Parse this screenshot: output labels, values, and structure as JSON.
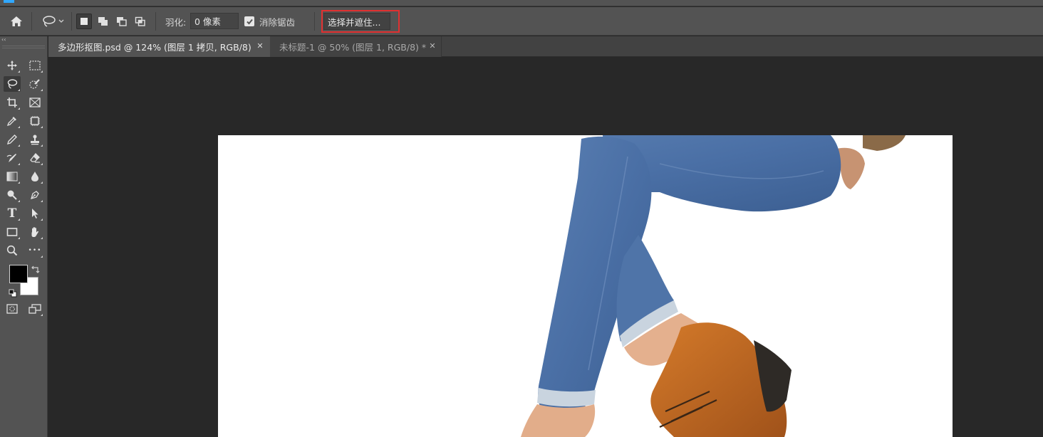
{
  "colors": {
    "panel": "#535353",
    "workspace": "#282828",
    "highlight": "#e03030",
    "foreground": "#000000",
    "background": "#ffffff"
  },
  "options_bar": {
    "feather_label": "羽化:",
    "feather_value": "0 像素",
    "antialias_label": "消除锯齿",
    "antialias_checked": true,
    "select_and_mask_label": "选择并遮住..."
  },
  "tabs": [
    {
      "title": "多边形抠图.psd @ 124% (图层 1 拷贝, RGB/8)",
      "active": true
    },
    {
      "title": "未标题-1 @ 50% (图层 1, RGB/8) *",
      "active": false
    }
  ],
  "toolbar": {
    "collapse_glyph": "‹‹",
    "tools": [
      "move-tool",
      "rectangular-marquee-tool",
      "lasso-tool",
      "quick-selection-tool",
      "crop-tool",
      "frame-tool",
      "eyedropper-tool",
      "content-aware-tool",
      "brush-tool",
      "clone-stamp-tool",
      "history-brush-tool",
      "eraser-tool",
      "gradient-tool",
      "blur-tool",
      "dodge-tool",
      "pen-tool",
      "type-tool",
      "path-selection-tool",
      "rectangle-tool",
      "hand-tool",
      "zoom-tool",
      "more-tools",
      "quick-mask",
      "screen-mode"
    ],
    "type_tool_glyph": "T",
    "more_glyph": "•••"
  }
}
